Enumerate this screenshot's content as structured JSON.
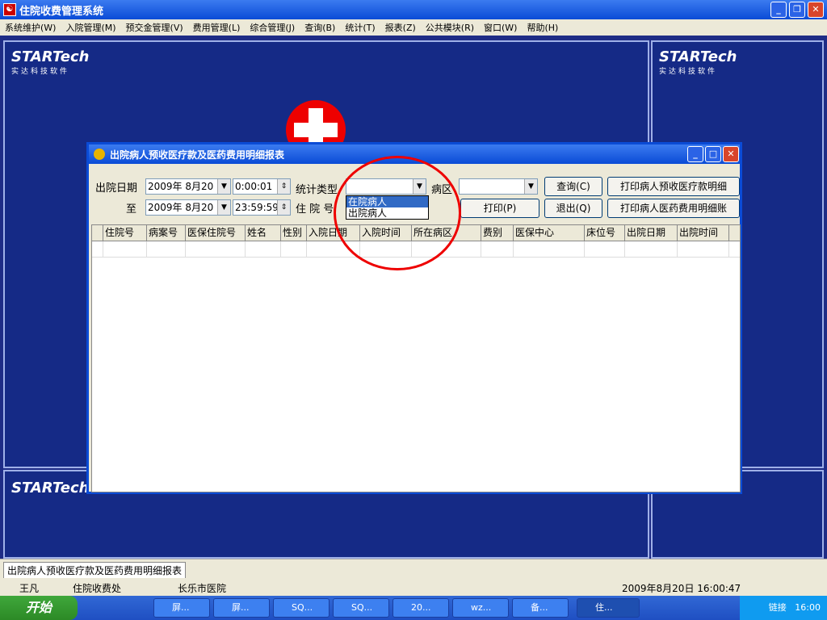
{
  "window": {
    "title": "住院收费管理系统"
  },
  "menu": [
    "系统维护(W)",
    "入院管理(M)",
    "预交金管理(V)",
    "费用管理(L)",
    "综合管理(J)",
    "查询(B)",
    "统计(T)",
    "报表(Z)",
    "公共模块(R)",
    "窗口(W)",
    "帮助(H)"
  ],
  "logo": {
    "brand": "STARTech",
    "sub": "实达科技软件"
  },
  "dialog": {
    "title": "出院病人预收医疗款及医药费用明细报表",
    "lbl_date": "出院日期",
    "lbl_to": "至",
    "date_from": "2009年 8月20",
    "time_from": "0:00:01",
    "date_to": "2009年 8月20",
    "time_to": "23:59:59",
    "lbl_type": "统计类型",
    "lbl_ward": "病区",
    "lbl_patno": "住 院 号",
    "btn_query": "查询(C)",
    "btn_print1": "打印病人预收医疗款明细",
    "btn_print": "打印(P)",
    "btn_exit": "退出(Q)",
    "btn_print2": "打印病人医药费用明细账",
    "options": [
      "在院病人",
      "出院病人"
    ],
    "columns": [
      "住院号",
      "病案号",
      "医保住院号",
      "姓名",
      "性别",
      "入院日期",
      "入院时间",
      "所在病区",
      "费别",
      "医保中心",
      "床位号",
      "出院日期",
      "出院时间"
    ]
  },
  "status": {
    "tab": "出院病人预收医疗款及医药费用明细报表",
    "user": "王凡",
    "dept": "住院收费处",
    "hospital": "长乐市医院",
    "datetime": "2009年8月20日 16:00:47"
  },
  "taskbar": {
    "start": "开始",
    "items": [
      "屏...",
      "屏...",
      "SQ...",
      "SQ...",
      "20...",
      "wz...",
      "备...",
      "住..."
    ],
    "links": "链接",
    "clock": "16:00"
  }
}
